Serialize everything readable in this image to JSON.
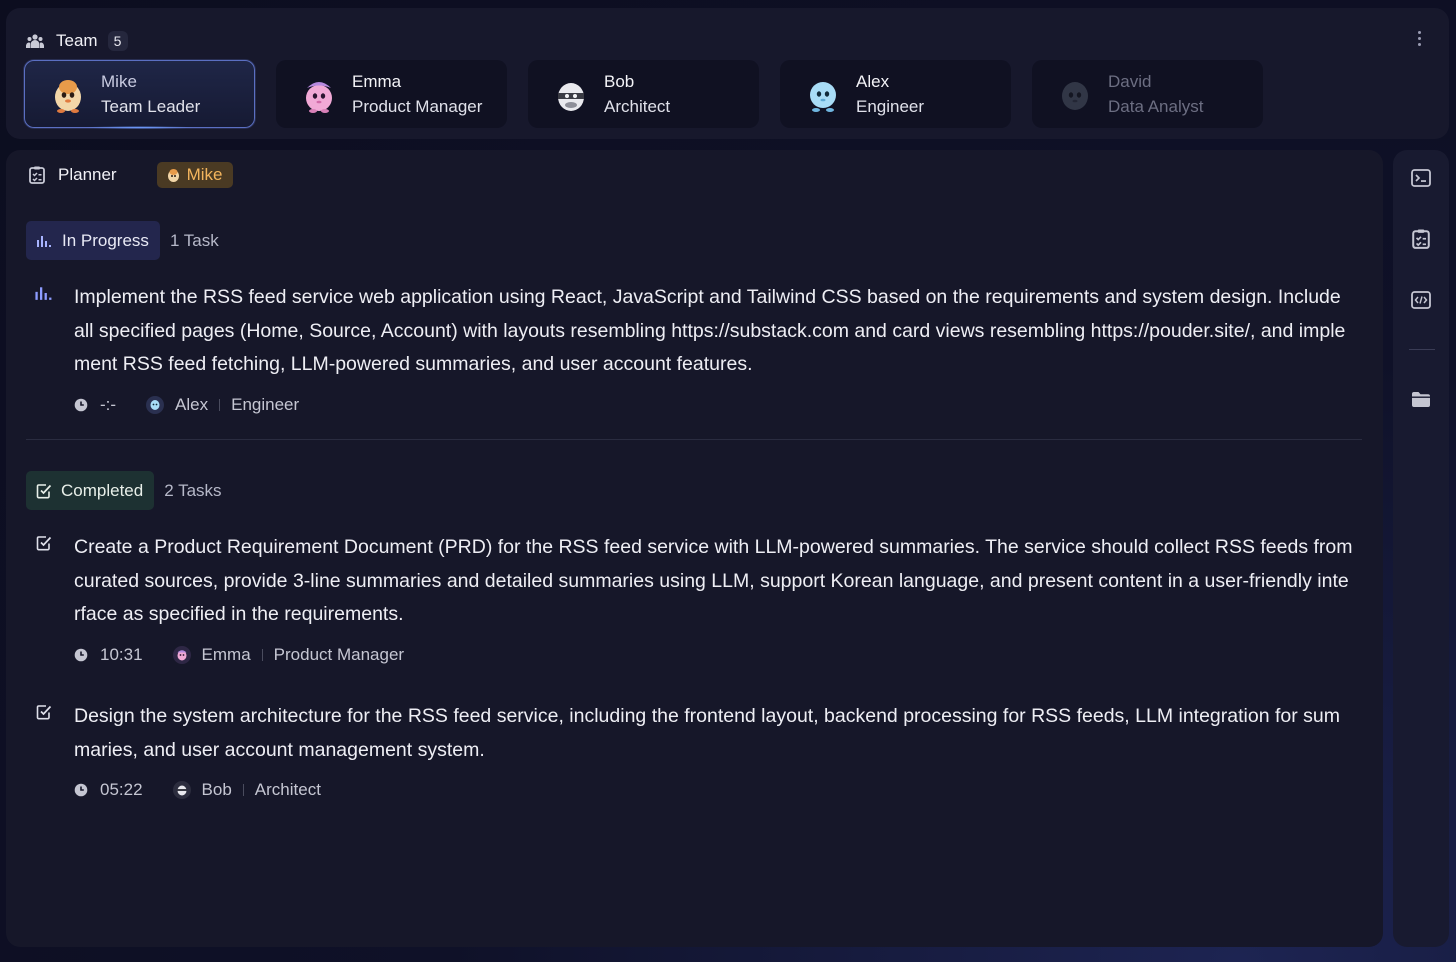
{
  "team": {
    "title": "Team",
    "count": "5",
    "members": [
      {
        "name": "Mike",
        "role": "Team Leader",
        "state": "active"
      },
      {
        "name": "Emma",
        "role": "Product Manager",
        "state": "normal"
      },
      {
        "name": "Bob",
        "role": "Architect",
        "state": "normal"
      },
      {
        "name": "Alex",
        "role": "Engineer",
        "state": "normal"
      },
      {
        "name": "David",
        "role": "Data Analyst",
        "state": "disabled"
      }
    ]
  },
  "planner": {
    "title": "Planner",
    "owner": "Mike",
    "in_progress": {
      "label": "In Progress",
      "count": "1 Task",
      "tasks": [
        {
          "description": "Implement the RSS feed service web application using React, JavaScript and Tailwind CSS based on the requirements and system design. Include all specified pages (Home, Source, Account) with layouts resembling https://substack.com and card views resembling https://pouder.site/, and implement RSS feed fetching, LLM-powered summaries, and user account features.",
          "time": "-:-",
          "assignee": "Alex",
          "role": "Engineer"
        }
      ]
    },
    "completed": {
      "label": "Completed",
      "count": "2 Tasks",
      "tasks": [
        {
          "description": "Create a Product Requirement Document (PRD) for the RSS feed service with LLM-powered summaries. The service should collect RSS feeds from curated sources, provide 3-line summaries and detailed summaries using LLM, support Korean language, and present content in a user-friendly interface as specified in the requirements.",
          "time": "10:31",
          "assignee": "Emma",
          "role": "Product Manager"
        },
        {
          "description": "Design the system architecture for the RSS feed service, including the frontend layout, backend processing for RSS feeds, LLM integration for summaries, and user account management system.",
          "time": "05:22",
          "assignee": "Bob",
          "role": "Architect"
        }
      ]
    }
  },
  "rail": {
    "icons": [
      "terminal-icon",
      "checklist-icon",
      "code-icon",
      "folder-icon"
    ]
  },
  "colors": {
    "accent": "#5b6fc2",
    "owner_badge_text": "#f3b55d",
    "progress_pill_bg": "#23264d",
    "completed_pill_bg": "#1d3132",
    "panel_bg": "#161729"
  }
}
